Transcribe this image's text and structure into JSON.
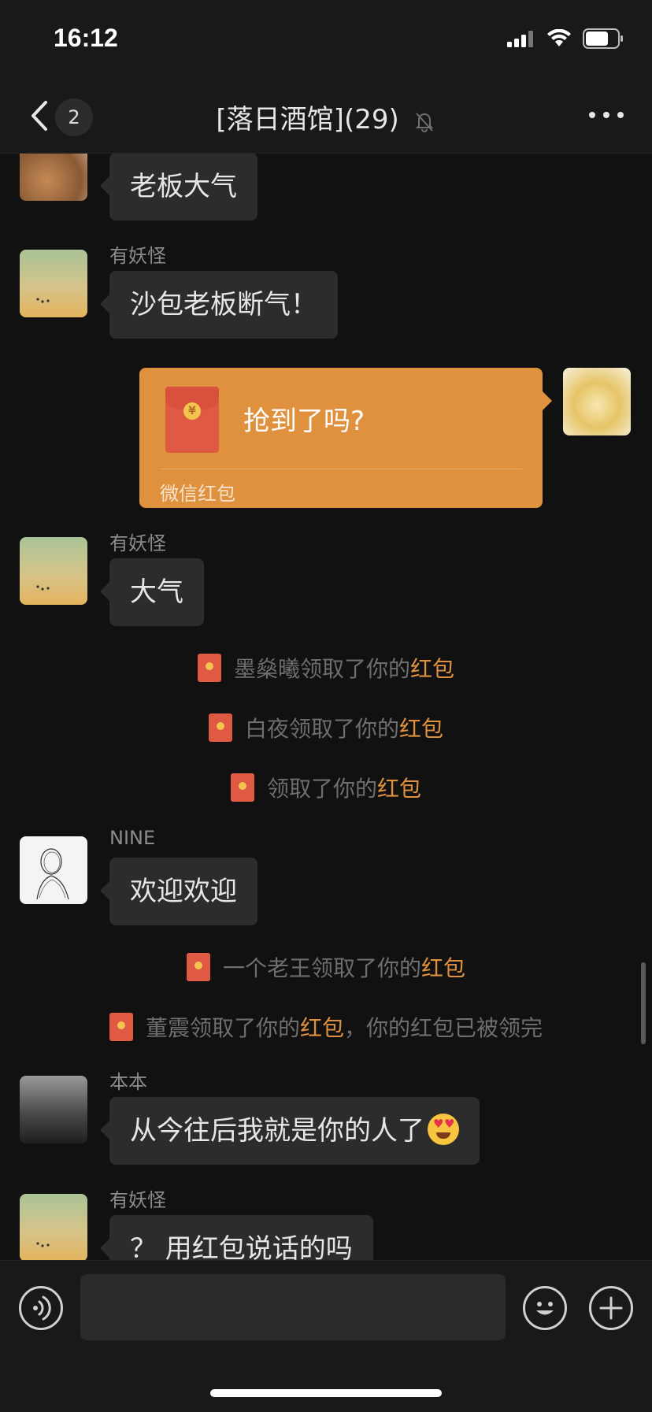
{
  "status": {
    "time": "16:12"
  },
  "header": {
    "back_badge": "2",
    "title": "[落日酒馆](29)"
  },
  "messages": [
    {
      "type": "text",
      "sender": "",
      "text": "老板大气"
    },
    {
      "type": "text",
      "sender": "有妖怪",
      "text": "沙包老板断气！"
    },
    {
      "type": "redpacket",
      "text": "抢到了吗?",
      "label": "微信红包"
    },
    {
      "type": "text",
      "sender": "有妖怪",
      "text": "大气"
    },
    {
      "type": "system",
      "before": "墨燊曦领取了你的",
      "link": "红包",
      "after": ""
    },
    {
      "type": "system",
      "before": "白夜领取了你的",
      "link": "红包",
      "after": ""
    },
    {
      "type": "system",
      "before": "领取了你的",
      "link": "红包",
      "after": ""
    },
    {
      "type": "text",
      "sender": "NINE",
      "text": "欢迎欢迎"
    },
    {
      "type": "system",
      "before": "一个老王领取了你的",
      "link": "红包",
      "after": ""
    },
    {
      "type": "system",
      "before": "董震领取了你的",
      "link": "红包",
      "after": "，你的红包已被领完"
    },
    {
      "type": "text",
      "sender": "本本",
      "text": "从今往后我就是你的人了",
      "emoji": "heart-eyes-drooling"
    },
    {
      "type": "text",
      "sender": "有妖怪",
      "text": "？ 用红包说话的吗"
    }
  ],
  "input": {
    "value": "",
    "placeholder": ""
  },
  "colors": {
    "background": "#111111",
    "bubble": "#2c2c2c",
    "redpacket": "#e0913e",
    "highlight": "#e0913e"
  }
}
